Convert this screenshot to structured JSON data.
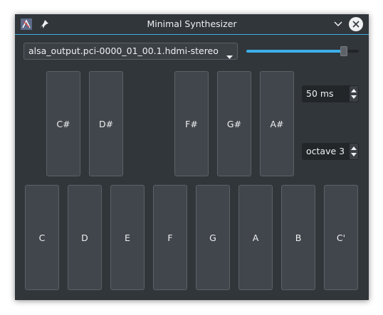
{
  "window": {
    "title": "Minimal Synthesizer"
  },
  "device": {
    "selected": "alsa_output.pci-0000_01_00.1.hdmi-stereo"
  },
  "volume": {
    "level": 0.87
  },
  "keys": {
    "black": [
      "C#",
      "D#",
      "F#",
      "G#",
      "A#"
    ],
    "white": [
      "C",
      "D",
      "E",
      "F",
      "G",
      "A",
      "B",
      "C'"
    ]
  },
  "duration": {
    "value": "50 ms"
  },
  "octave": {
    "value": "octave 3"
  },
  "colors": {
    "accent": "#3daee9",
    "background": "#31363b",
    "key": "#41464c"
  }
}
